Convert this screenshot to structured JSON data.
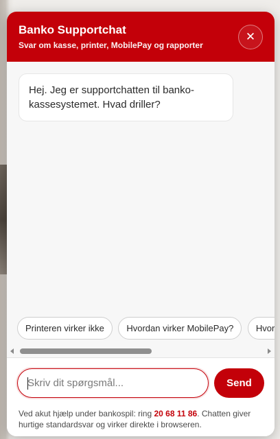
{
  "header": {
    "title": "Banko Supportchat",
    "subtitle": "Svar om kasse, printer, MobilePay og rapporter",
    "close_label": "✕"
  },
  "messages": [
    {
      "from": "bot",
      "text": "Hej. Jeg er supportchatten til banko-kassesystemet. Hvad driller?"
    }
  ],
  "suggestions": [
    "Printeren virker ikke",
    "Hvordan virker MobilePay?",
    "Hvordan"
  ],
  "composer": {
    "placeholder": "Skriv dit spørgsmål...",
    "value": "",
    "send_label": "Send"
  },
  "footnote": {
    "before": "Ved akut hjælp under bankospil: ring ",
    "phone": "20 68 11 86",
    "after": ". Chatten giver hurtige standardsvar og virker direkte i browseren."
  },
  "colors": {
    "brand": "#c30009",
    "chat_background": "#f7f7f7"
  },
  "icons": {
    "close": "close-icon",
    "scroll_left": "chevron-left-icon",
    "scroll_right": "chevron-right-icon"
  }
}
